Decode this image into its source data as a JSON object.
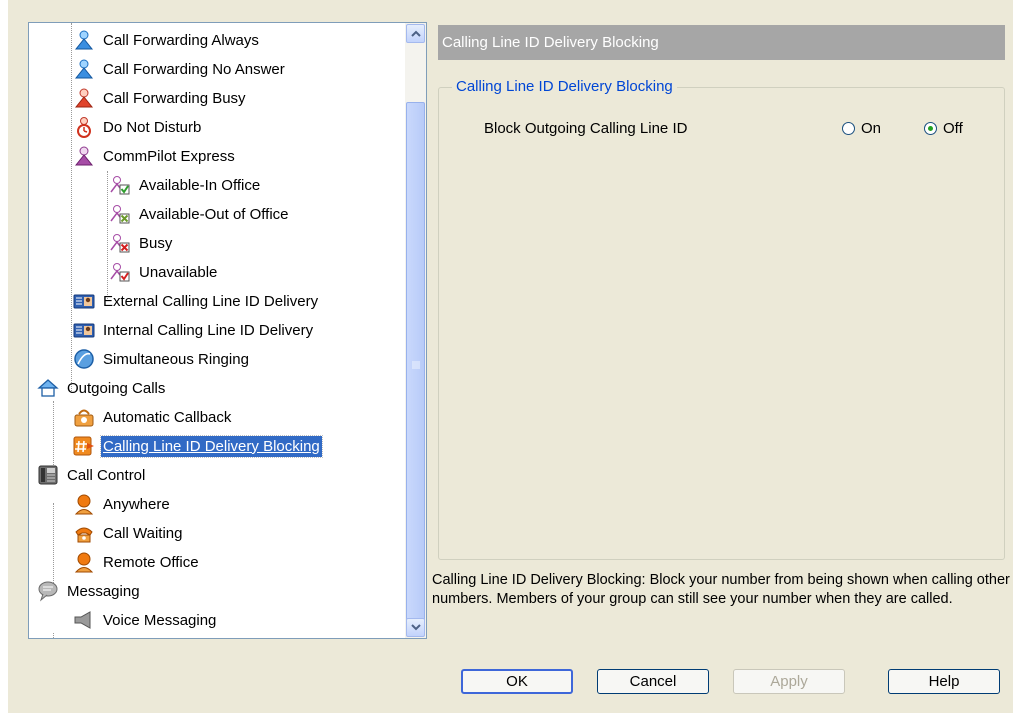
{
  "tree": {
    "items": [
      {
        "label": "Call Forwarding Always",
        "icon": "call-forwarding-person-blue-icon"
      },
      {
        "label": "Call Forwarding No Answer",
        "icon": "call-forwarding-person-blue-icon"
      },
      {
        "label": "Call Forwarding Busy",
        "icon": "call-forwarding-person-red-icon"
      },
      {
        "label": "Do Not Disturb",
        "icon": "do-not-disturb-icon"
      },
      {
        "label": "CommPilot Express",
        "icon": "commpilot-person-purple-icon"
      },
      {
        "label": "Available-In Office",
        "icon": "available-check-icon"
      },
      {
        "label": "Available-Out of Office",
        "icon": "available-out-icon"
      },
      {
        "label": "Busy",
        "icon": "busy-x-icon"
      },
      {
        "label": "Unavailable",
        "icon": "unavailable-check-icon"
      },
      {
        "label": "External Calling Line ID Delivery",
        "icon": "id-card-icon"
      },
      {
        "label": "Internal Calling Line ID Delivery",
        "icon": "id-card-icon"
      },
      {
        "label": "Simultaneous Ringing",
        "icon": "globe-icon"
      },
      {
        "label": "Outgoing Calls",
        "icon": "house-icon"
      },
      {
        "label": "Automatic Callback",
        "icon": "callback-phone-icon"
      },
      {
        "label": "Calling Line ID Delivery Blocking",
        "icon": "hash-arrow-icon"
      },
      {
        "label": "Call Control",
        "icon": "desk-phone-icon"
      },
      {
        "label": "Anywhere",
        "icon": "orange-person-icon"
      },
      {
        "label": "Call Waiting",
        "icon": "phone-waiting-icon"
      },
      {
        "label": "Remote Office",
        "icon": "orange-person-icon"
      },
      {
        "label": "Messaging",
        "icon": "speech-bubble-icon"
      },
      {
        "label": "Voice Messaging",
        "icon": "speaker-icon"
      }
    ],
    "selected_label": "Calling Line ID Delivery Blocking"
  },
  "panel": {
    "header": "Calling Line ID Delivery Blocking",
    "group_title": "Calling Line ID Delivery Blocking",
    "option_label": "Block Outgoing Calling Line ID",
    "radio_on": "On",
    "radio_off": "Off",
    "selected": "Off",
    "description": "Calling Line ID Delivery Blocking: Block your number from being shown when calling other numbers. Members of your group can still see your number when they are called."
  },
  "buttons": {
    "ok": "OK",
    "cancel": "Cancel",
    "apply": "Apply",
    "help": "Help"
  },
  "colors": {
    "selection": "#316ac5",
    "header_bg": "#a6a6a6",
    "dialog_bg": "#ece9d8",
    "group_title": "#0046d5"
  }
}
